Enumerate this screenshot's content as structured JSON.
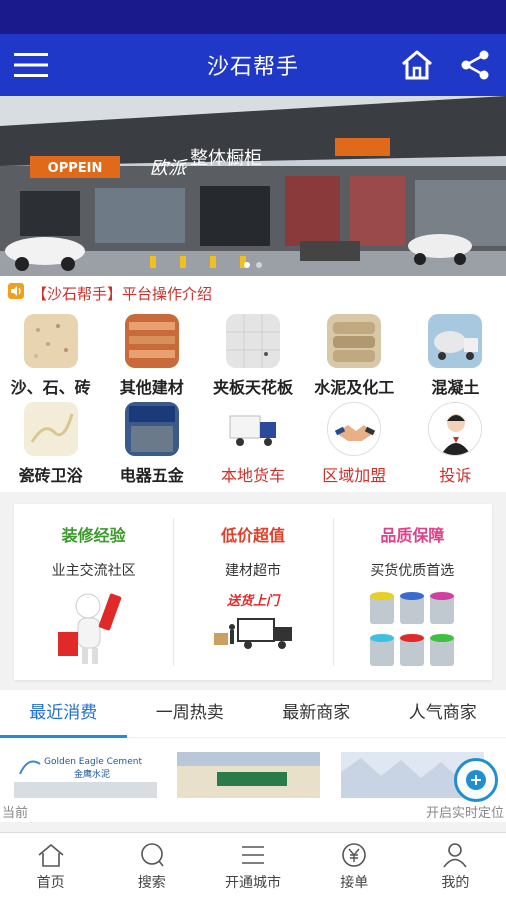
{
  "header": {
    "title": "沙石帮手"
  },
  "notice": {
    "text": "【沙石帮手】平台操作介绍"
  },
  "categories": [
    {
      "label": "沙、石、砖"
    },
    {
      "label": "其他建材"
    },
    {
      "label": "夹板天花板"
    },
    {
      "label": "水泥及化工"
    },
    {
      "label": "混凝土"
    },
    {
      "label": "瓷砖卫浴"
    },
    {
      "label": "电器五金"
    },
    {
      "label": "本地货车"
    },
    {
      "label": "区域加盟"
    },
    {
      "label": "投诉"
    }
  ],
  "promo": [
    {
      "heading": "装修经验",
      "sub": "业主交流社区",
      "color": "#3a9a2a"
    },
    {
      "heading": "低价超值",
      "sub": "建材超市",
      "color": "#e0402a",
      "tag": "送货上门"
    },
    {
      "heading": "品质保障",
      "sub": "买货优质首选",
      "color": "#e0408a"
    }
  ],
  "tabs": [
    "最近消费",
    "一周热卖",
    "最新商家",
    "人气商家"
  ],
  "shops": [
    {
      "sign": "Golden Eagle Cement",
      "sign_cn": "金鹰水泥"
    },
    {
      "sign": ""
    },
    {
      "sign": ""
    }
  ],
  "location": {
    "left": "当前",
    "right": "开启实时定位"
  },
  "bottom_nav": [
    "首页",
    "搜索",
    "开通城市",
    "接单",
    "我的"
  ],
  "banner": {
    "brand": "OPPEIN",
    "brand_cn": "欧派",
    "tagline": "整体橱柜"
  },
  "colors": {
    "header": "#1f38c8",
    "status": "#1a1a8c",
    "accent": "#1f8fd0",
    "red": "#d0302a"
  }
}
